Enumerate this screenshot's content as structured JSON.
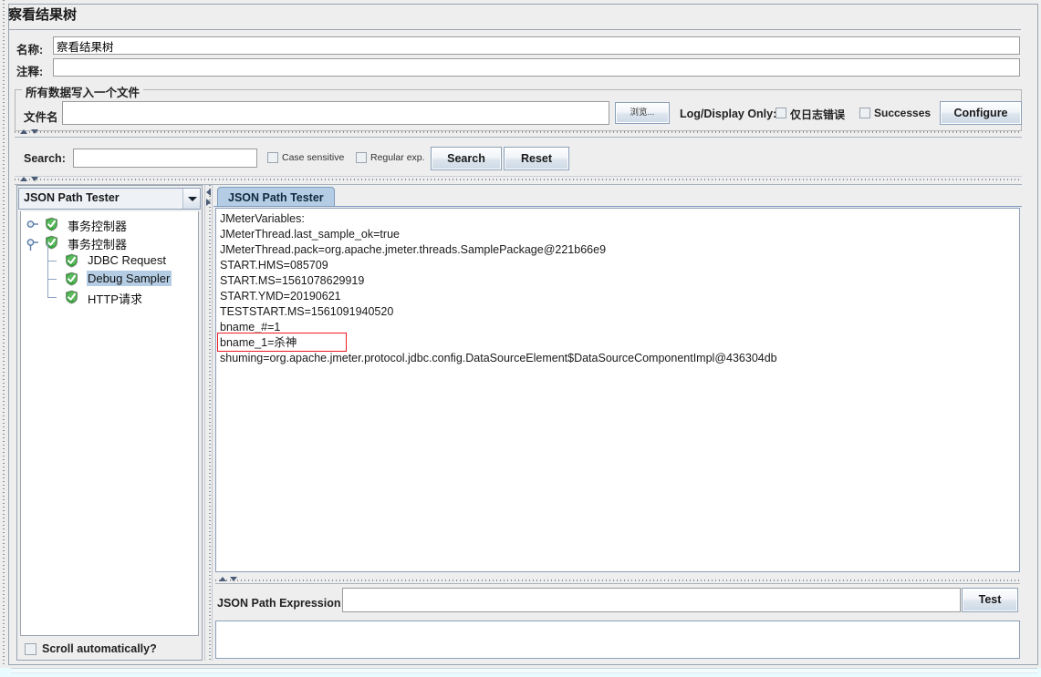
{
  "window": {
    "title": "察看结果树"
  },
  "fields": {
    "name_label": "名称:",
    "name_value": "察看结果树",
    "comment_label": "注释:",
    "comment_value": ""
  },
  "filegroup": {
    "legend": "所有数据写入一个文件",
    "filename_label": "文件名",
    "filename_value": "",
    "browse_label": "浏览...",
    "logdisplay_label": "Log/Display Only:",
    "errors_label": "仅日志错误",
    "errors_checked": false,
    "successes_label": "Successes",
    "successes_checked": false,
    "configure_label": "Configure"
  },
  "search": {
    "label": "Search:",
    "value": "",
    "case_sensitive_label": "Case sensitive",
    "case_sensitive_checked": false,
    "regular_exp_label": "Regular exp.",
    "regular_exp_checked": false,
    "search_button": "Search",
    "reset_button": "Reset"
  },
  "left_panel": {
    "view_selector_value": "JSON Path Tester",
    "tree": [
      {
        "label": "事务控制器",
        "depth": 0,
        "selected": false,
        "handle": "collapsed"
      },
      {
        "label": "事务控制器",
        "depth": 0,
        "selected": false,
        "handle": "expanded"
      },
      {
        "label": "JDBC Request",
        "depth": 1,
        "selected": false,
        "handle": "none"
      },
      {
        "label": "Debug Sampler",
        "depth": 1,
        "selected": true,
        "handle": "none"
      },
      {
        "label": "HTTP请求",
        "depth": 1,
        "selected": false,
        "handle": "none"
      }
    ],
    "scroll_auto_label": "Scroll automatically?",
    "scroll_auto_checked": false
  },
  "right_panel": {
    "tab_label": "JSON Path Tester",
    "content_lines": [
      "JMeterVariables:",
      "JMeterThread.last_sample_ok=true",
      "JMeterThread.pack=org.apache.jmeter.threads.SamplePackage@221b66e9",
      "START.HMS=085709",
      "START.MS=1561078629919",
      "START.YMD=20190621",
      "TESTSTART.MS=1561091940520",
      "bname_#=1",
      "bname_1=杀神",
      "shuming=org.apache.jmeter.protocol.jdbc.config.DataSourceElement$DataSourceComponentImpl@436304db"
    ],
    "highlighted_line_index": 8,
    "expression_label": "JSON Path Expression",
    "expression_value": "",
    "test_button": "Test",
    "result_value": ""
  },
  "colors": {
    "accent": "#b4cde4",
    "annotation": "#ee1b24",
    "shield_green": "#35a23a",
    "panel_bg": "#eeeeee",
    "field_bg": "#ffffff"
  },
  "icons": {
    "combo_arrow": "chevron-down-icon",
    "node_status": "green-shield-check-icon",
    "divider_up": "triangle-up-icon",
    "divider_down": "triangle-down-icon"
  }
}
